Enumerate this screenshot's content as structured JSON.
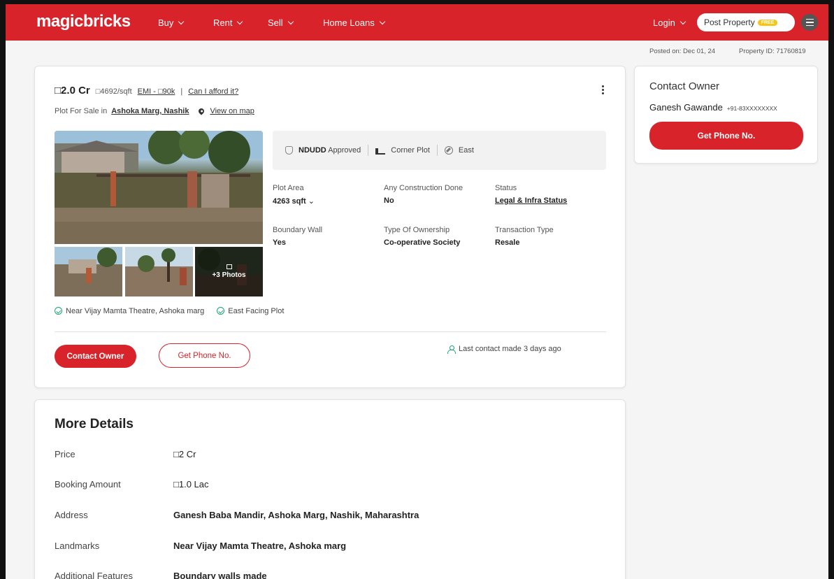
{
  "header": {
    "logo": "magicbricks",
    "nav": [
      "Buy",
      "Rent",
      "Sell",
      "Home Loans"
    ],
    "login_label": "Login",
    "post_property_label": "Post Property",
    "free_badge": "FREE",
    "brand_color": "#d8232a"
  },
  "meta": {
    "posted_on": "Posted on: Dec 01, 24",
    "property_id": "Property ID: 71760819"
  },
  "listing": {
    "price": "□2.0 Cr",
    "price_per_sqft": "□4692/sqft",
    "emi": "EMI - □90k",
    "separator": "|",
    "afford": "Can I afford it?",
    "title_prefix": "Plot For Sale in",
    "location": "Ashoka Marg, Nashik",
    "view_on_map": "View on map",
    "photos_more": "+3 Photos",
    "facts": {
      "approval_name": "NDUDD",
      "approval_suffix": "Approved",
      "corner": "Corner Plot",
      "facing": "East"
    },
    "attributes": [
      {
        "label": "Plot Area",
        "value": "4263 sqft"
      },
      {
        "label": "Any Construction Done",
        "value": "No"
      },
      {
        "label": "Status",
        "value": "Legal & Infra Status"
      },
      {
        "label": "Boundary Wall",
        "value": "Yes"
      },
      {
        "label": "Type Of Ownership",
        "value": "Co-operative Society"
      },
      {
        "label": "Transaction Type",
        "value": "Resale"
      }
    ],
    "highlights": [
      "Near Vijay Mamta Theatre, Ashoka marg",
      "East Facing Plot"
    ],
    "contact_owner_label": "Contact Owner",
    "get_phone_label": "Get Phone No.",
    "last_contact": "Last contact made 3 days ago"
  },
  "more_details": {
    "title": "More Details",
    "rows": [
      {
        "key": "Price",
        "value": "□2 Cr"
      },
      {
        "key": "Booking Amount",
        "value": "□1.0 Lac"
      },
      {
        "key": "Address",
        "value": "Ganesh Baba Mandir, Ashoka Marg, Nashik, Maharashtra"
      },
      {
        "key": "Landmarks",
        "value": "Near Vijay Mamta Theatre, Ashoka marg"
      },
      {
        "key": "Additional Features",
        "value": "Boundary walls made"
      }
    ]
  },
  "contact_card": {
    "title": "Contact Owner",
    "owner_name": "Ganesh Gawande",
    "owner_phone": "+91-83XXXXXXXX",
    "get_phone_label": "Get Phone No."
  }
}
